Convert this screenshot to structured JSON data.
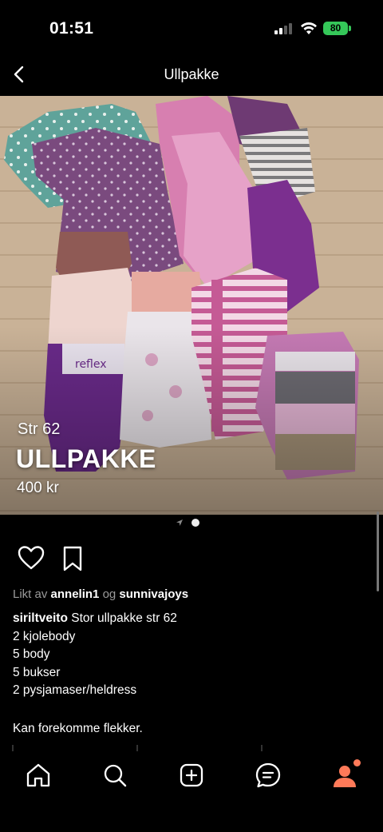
{
  "status": {
    "time": "01:51",
    "battery": "80"
  },
  "nav": {
    "title": "Ullpakke",
    "back_icon": "chevron-left-icon"
  },
  "listing": {
    "size_label": "Str 62",
    "title": "ULLPAKKE",
    "price": "400 kr",
    "clothing_tag_text": "reflex"
  },
  "actions": {
    "like_icon": "heart-icon",
    "save_icon": "bookmark-icon"
  },
  "likes": {
    "prefix": "Likt av",
    "user1": "annelin1",
    "conj": "og",
    "user2": "sunnivajoys"
  },
  "caption": {
    "username": "siriltveito",
    "first_line": "Stor ullpakke str 62",
    "lines": [
      "2 kjolebody",
      "5 body",
      "5 bukser",
      "2 pysjamaser/heldress"
    ],
    "note": "Kan forekomme flekker."
  },
  "tabbar": {
    "items": [
      "home-icon",
      "search-icon",
      "add-icon",
      "messages-icon",
      "profile-icon"
    ]
  },
  "colors": {
    "accent": "#ff7a59",
    "background": "#000000",
    "battery": "#35c759"
  }
}
